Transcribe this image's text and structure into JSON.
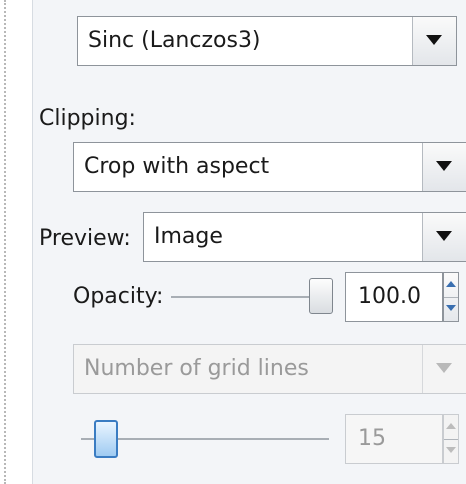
{
  "resampling": {
    "selected": "Sinc (Lanczos3)"
  },
  "clipping": {
    "label": "Clipping:",
    "selected": "Crop with aspect"
  },
  "preview": {
    "label": "Preview:",
    "selected": "Image"
  },
  "opacity": {
    "label": "Opacity:",
    "value": "100.0",
    "level": 1.0
  },
  "guides": {
    "selected": "Number of grid lines",
    "count_value": "15",
    "slider_level": 0.1
  },
  "colors": {
    "panel_bg": "#f3f5f8",
    "slider_thumb_active": "#9fcbf2",
    "disabled_text": "#9a9a9a"
  },
  "icons": {
    "dropdown": "triangle-down",
    "spin_up": "triangle-up",
    "spin_down": "triangle-down"
  }
}
